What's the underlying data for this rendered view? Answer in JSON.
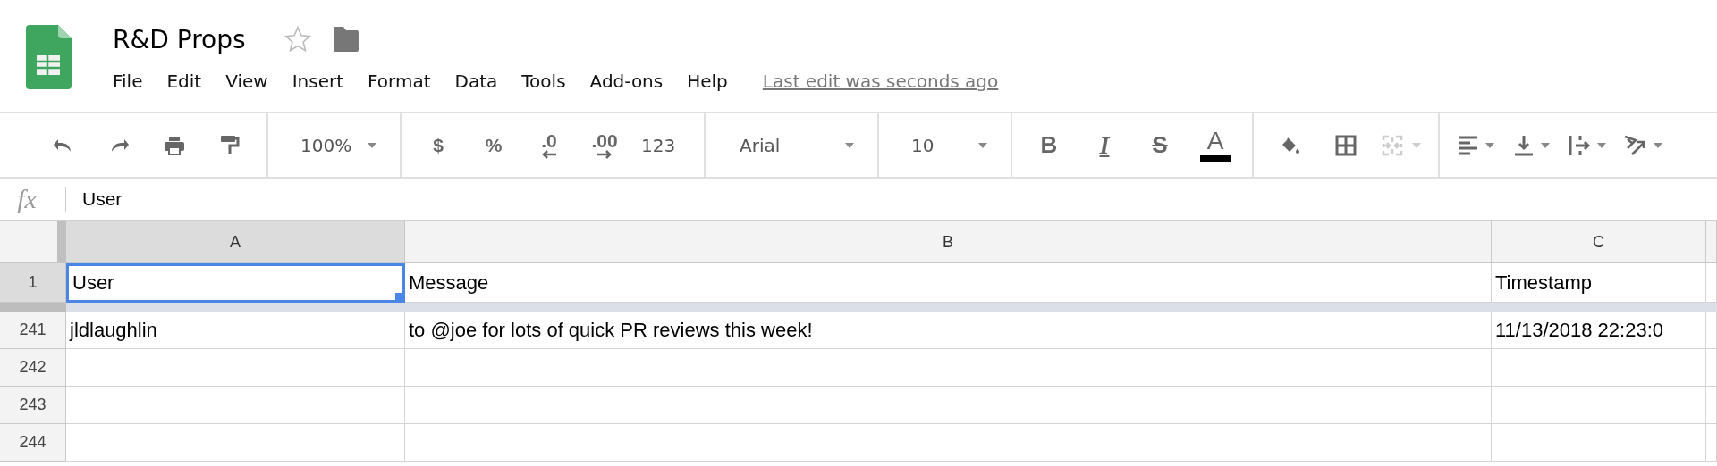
{
  "document": {
    "title": "R&D Props",
    "starred": false
  },
  "menu": [
    {
      "label": "File"
    },
    {
      "label": "Edit"
    },
    {
      "label": "View"
    },
    {
      "label": "Insert"
    },
    {
      "label": "Format"
    },
    {
      "label": "Data"
    },
    {
      "label": "Tools"
    },
    {
      "label": "Add-ons"
    },
    {
      "label": "Help"
    }
  ],
  "last_edit": "Last edit was seconds ago",
  "toolbar": [
    {
      "items": [
        {
          "kind": "undo",
          "disabled": false
        },
        {
          "kind": "redo",
          "disabled": false
        },
        {
          "kind": "print",
          "disabled": false
        },
        {
          "kind": "paint",
          "disabled": false
        }
      ]
    },
    {
      "items": [
        {
          "kind": "zoom",
          "label": "100%",
          "disabled": false
        }
      ]
    },
    {
      "items": [
        {
          "kind": "text",
          "label": "$",
          "disabled": false
        },
        {
          "kind": "text",
          "label": "%",
          "disabled": false
        },
        {
          "kind": "decrease",
          "label": ".0",
          "disabled": false
        },
        {
          "kind": "increase",
          "label": ".00",
          "disabled": false
        },
        {
          "kind": "numformat",
          "label": "123",
          "disabled": false
        }
      ]
    },
    {
      "items": [
        {
          "kind": "font",
          "label": "Arial",
          "disabled": false
        }
      ]
    },
    {
      "items": [
        {
          "kind": "zoom",
          "label": "10",
          "disabled": false
        }
      ]
    },
    {
      "items": [
        {
          "kind": "bold",
          "label": "B",
          "disabled": false
        },
        {
          "kind": "italic",
          "label": "I",
          "disabled": false
        },
        {
          "kind": "strike",
          "label": "S",
          "disabled": false
        },
        {
          "kind": "color",
          "label": "A",
          "disabled": false
        }
      ]
    },
    {
      "items": [
        {
          "kind": "fill",
          "disabled": false
        },
        {
          "kind": "borders",
          "disabled": false
        },
        {
          "kind": "merge",
          "disabled": true
        }
      ]
    },
    {
      "items": [
        {
          "kind": "align",
          "disabled": false
        },
        {
          "kind": "valign",
          "disabled": false
        },
        {
          "kind": "wrap",
          "disabled": false
        },
        {
          "kind": "rotate",
          "disabled": false
        }
      ]
    }
  ],
  "formula_bar": {
    "label": "fx",
    "value": "User"
  },
  "sheet": {
    "columns": [
      {
        "label": "A",
        "selected": true
      },
      {
        "label": "B",
        "selected": false
      },
      {
        "label": "C",
        "selected": false
      }
    ],
    "frozen_rows": [
      {
        "number": "1",
        "selected": true,
        "cells": [
          {
            "text": "User",
            "selected": true
          },
          {
            "text": "Message",
            "selected": false
          },
          {
            "text": "Timestamp",
            "selected": false
          }
        ]
      }
    ],
    "rows": [
      {
        "number": "241",
        "selected": false,
        "cells": [
          {
            "text": "jldlaughlin",
            "selected": false
          },
          {
            "text": "to @joe for lots of quick PR reviews this week!",
            "selected": false
          },
          {
            "text": "11/13/2018 22:23:0",
            "selected": false
          }
        ]
      },
      {
        "number": "242",
        "selected": false,
        "cells": [
          {
            "selected": false
          },
          {
            "selected": false
          },
          {
            "selected": false
          }
        ]
      },
      {
        "number": "243",
        "selected": false,
        "cells": [
          {
            "selected": false
          },
          {
            "selected": false
          },
          {
            "selected": false
          }
        ]
      },
      {
        "number": "244",
        "selected": false,
        "cells": [
          {
            "selected": false
          },
          {
            "selected": false
          },
          {
            "selected": false
          }
        ]
      }
    ]
  }
}
